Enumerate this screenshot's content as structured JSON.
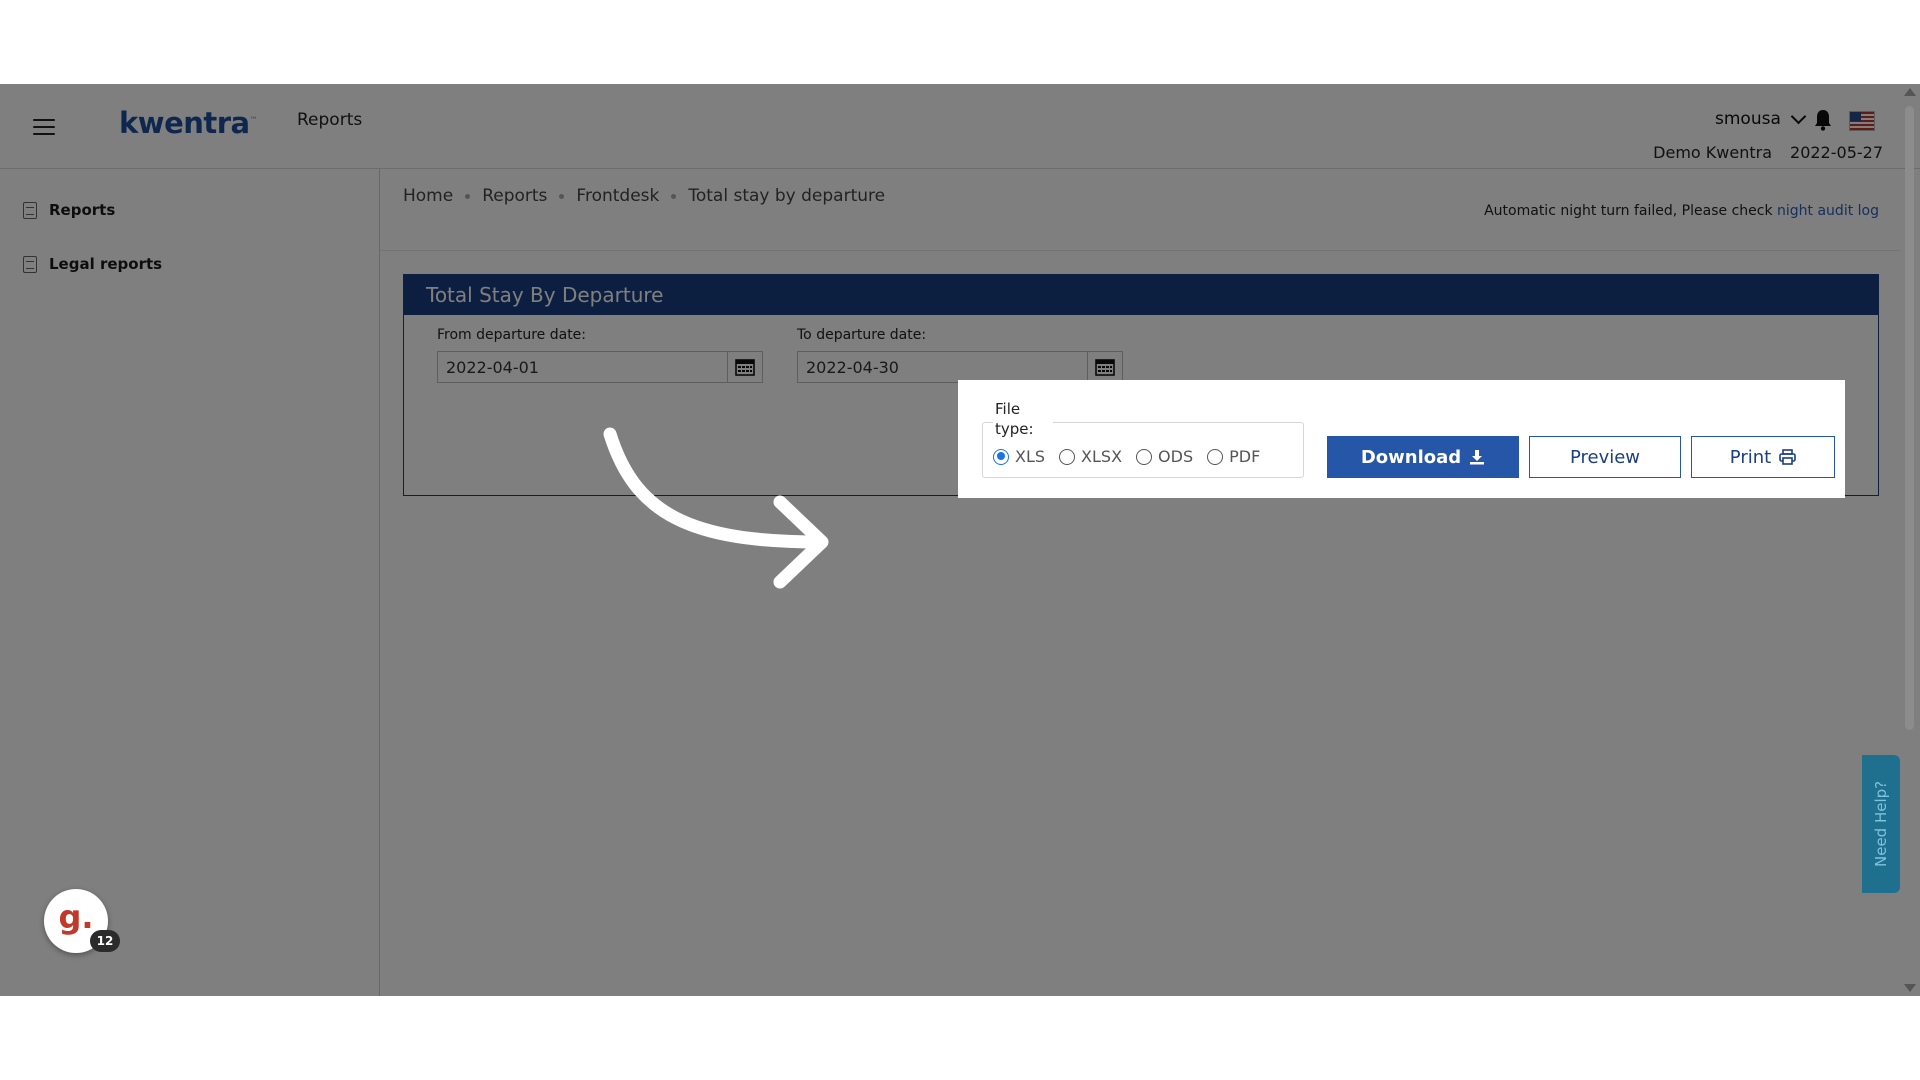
{
  "topbar": {
    "logo": "kwentra",
    "logo_mark": "™",
    "title": "Reports",
    "username": "smousa",
    "hotel": "Demo Kwentra",
    "date": "2022-05-27"
  },
  "sidebar": {
    "items": [
      {
        "label": "Reports"
      },
      {
        "label": "Legal reports"
      }
    ],
    "widget_letter": "g.",
    "widget_badge": "12"
  },
  "breadcrumb": [
    "Home",
    "Reports",
    "Frontdesk",
    "Total stay by departure"
  ],
  "notice": {
    "text": "Automatic night turn failed, Please check ",
    "link": "night audit log"
  },
  "panel": {
    "title": "Total Stay By Departure",
    "from_label": "From departure date:",
    "from_value": "2022-04-01",
    "to_label": "To departure date:",
    "to_value": "2022-04-30"
  },
  "filetype": {
    "legend": "File type:",
    "options": [
      "XLS",
      "XLSX",
      "ODS",
      "PDF"
    ],
    "selected": "XLS"
  },
  "buttons": {
    "download": "Download",
    "preview": "Preview",
    "print": "Print"
  },
  "help": "Need Help?",
  "colors": {
    "header_blue": "#1b3f82",
    "button_blue": "#2556a8",
    "help_teal": "#1f6f8e"
  }
}
